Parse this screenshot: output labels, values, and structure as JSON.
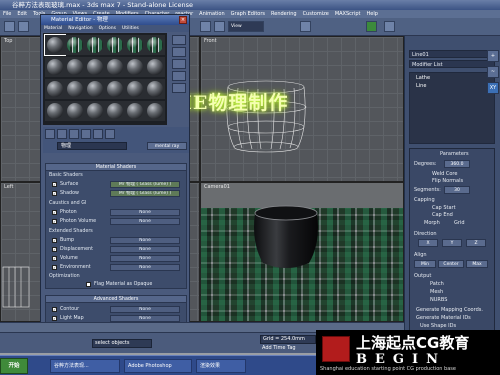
{
  "window": {
    "title": "谷粹方法表现玻璃.max - 3ds max 7 - Stand-alone License"
  },
  "menubar": {
    "items": [
      "File",
      "Edit",
      "Tools",
      "Group",
      "Views",
      "Create",
      "Modifiers",
      "Character",
      "reactor",
      "Animation",
      "Graph Editors",
      "Rendering",
      "Customize",
      "MAXScript",
      "Help"
    ]
  },
  "viewports": {
    "top_left_label": "Top",
    "top_right_label": "Front",
    "bottom_left_label": "Left",
    "camera_label": "Camera01",
    "view_dropdown": "View"
  },
  "overlay_title": "LUME物理制作",
  "material_editor": {
    "title": "Material Editor - 物理",
    "menu": [
      "Material",
      "Navigation",
      "Options",
      "Utilities"
    ],
    "material_name": "物理",
    "material_type": "mental ray",
    "rollout_material_shaders": "Material Shaders",
    "basic_shaders_label": "Basic Shaders",
    "surface_label": "Surface",
    "surface_value": "Mr 物理 ( Glass (lume) )",
    "shadow_label": "Shadow",
    "shadow_value": "Mr 物理 ( Glass (lume) )",
    "caustics_label": "Caustics and GI",
    "photon_label": "Photon",
    "photon_value": "None",
    "photon_volume_label": "Photon Volume",
    "photon_volume_value": "None",
    "extended_label": "Extended Shaders",
    "bump_label": "Bump",
    "bump_value": "None",
    "displacement_label": "Displacement",
    "displacement_value": "None",
    "volume_label": "Volume",
    "volume_value": "None",
    "environment_label": "Environment",
    "environment_value": "None",
    "optimization_label": "Optimization",
    "flag_opaque_label": "Flag Material as Opaque",
    "rollout_advanced": "Advanced Shaders",
    "contour_label": "Contour",
    "contour_value": "None",
    "lightmap_label": "Light Map",
    "lightmap_value": "None"
  },
  "command_panel": {
    "object_name": "Line01",
    "modifier_list": "Modifier List",
    "stack_items": [
      "Lathe",
      "Line"
    ],
    "parameters_header": "Parameters",
    "degrees_label": "Degrees:",
    "degrees_value": "360.0",
    "weld_core": "Weld Core",
    "flip_normals": "Flip Normals",
    "segments_label": "Segments:",
    "segments_value": "30",
    "capping_label": "Capping",
    "cap_start": "Cap Start",
    "cap_end": "Cap End",
    "morph": "Morph",
    "grid": "Grid",
    "direction_label": "Direction",
    "axis_x": "X",
    "axis_y": "Y",
    "axis_z": "Z",
    "align_label": "Align",
    "align_min": "Min",
    "align_center": "Center",
    "align_max": "Max",
    "output_label": "Output",
    "output_patch": "Patch",
    "output_mesh": "Mesh",
    "output_nurbs": "NURBS",
    "gen_mapping": "Generate Mapping Coords.",
    "gen_material": "Generate Material IDs",
    "use_shape": "Use Shape IDs"
  },
  "statusbar": {
    "select_text": "select objects",
    "grid_text": "Grid = 254.0mm",
    "add_time_tag": "Add Time Tag"
  },
  "taskbar": {
    "start": "开始",
    "tasks": [
      "谷粹方法表现...",
      "Adobe Photoshop",
      "渲染效果"
    ]
  },
  "logo": {
    "line1": "上海起点CG教育",
    "line2": "BEGIN",
    "tagline": "Shanghai education starting point CG production base"
  },
  "colors": {
    "overlay_glow": "#c8ff40",
    "seal_red": "#b21c1c",
    "title_blue": "#3c5384"
  }
}
